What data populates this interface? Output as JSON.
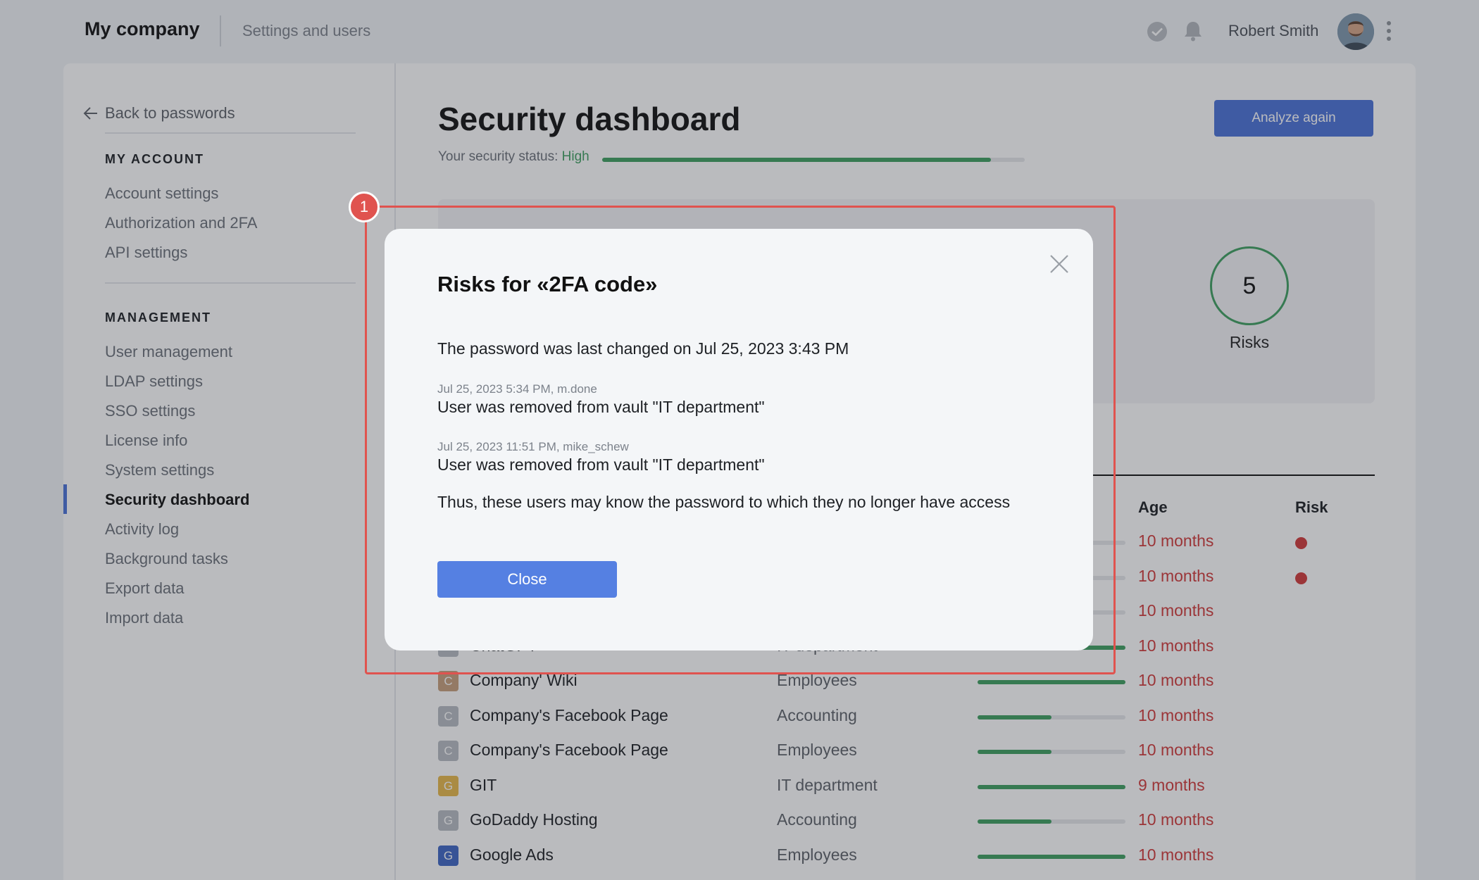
{
  "header": {
    "brand": "My company",
    "section": "Settings and users",
    "user_name": "Robert Smith"
  },
  "sidebar": {
    "back_label": "Back to passwords",
    "my_account_heading": "MY ACCOUNT",
    "my_account_items": [
      "Account settings",
      "Authorization and 2FA",
      "API settings"
    ],
    "management_heading": "MANAGEMENT",
    "management_items": [
      "User management",
      "LDAP settings",
      "SSO settings",
      "License info",
      "System settings",
      "Security dashboard",
      "Activity log",
      "Background tasks",
      "Export data",
      "Import data"
    ],
    "active_item": "Security dashboard"
  },
  "dashboard": {
    "title": "Security dashboard",
    "analyze_button": "Analyze again",
    "status_label": "Your security status:",
    "status_value": "High",
    "status_progress": 0.92,
    "risks_count": "5",
    "risks_label": "Risks",
    "columns": {
      "age": "Age",
      "risk": "Risk"
    },
    "rows": [
      {
        "name": "",
        "vault": "",
        "strength": 0.5,
        "age": "10 months",
        "risk": true
      },
      {
        "name": "",
        "vault": "",
        "strength": 0.5,
        "age": "10 months",
        "risk": true
      },
      {
        "name": "",
        "vault": "",
        "strength": 0.5,
        "age": "10 months",
        "risk": false
      },
      {
        "name": "ChatGPT",
        "letter": "C",
        "badge_color": "#b7bcc3",
        "vault": "IT department",
        "strength": 1.0,
        "age": "10 months",
        "risk": false
      },
      {
        "name": "Company' Wiki",
        "letter": "C",
        "badge_color": "#c7a07c",
        "vault": "Employees",
        "strength": 1.0,
        "age": "10 months",
        "risk": false
      },
      {
        "name": "Company's Facebook Page",
        "letter": "C",
        "badge_color": "#b7bcc3",
        "vault": "Accounting",
        "strength": 0.5,
        "age": "10 months",
        "risk": false
      },
      {
        "name": "Company's Facebook Page",
        "letter": "C",
        "badge_color": "#b7bcc3",
        "vault": "Employees",
        "strength": 0.5,
        "age": "10 months",
        "risk": false
      },
      {
        "name": "GIT",
        "letter": "G",
        "badge_color": "#e8b84a",
        "vault": "IT department",
        "strength": 1.0,
        "age": "9 months",
        "risk": false
      },
      {
        "name": "GoDaddy Hosting",
        "letter": "G",
        "badge_color": "#b7bcc3",
        "vault": "Accounting",
        "strength": 0.5,
        "age": "10 months",
        "risk": false
      },
      {
        "name": "Google Ads",
        "letter": "G",
        "badge_color": "#3f66c4",
        "vault": "Employees",
        "strength": 1.0,
        "age": "10 months",
        "risk": false
      }
    ]
  },
  "annotation": {
    "marker": "1",
    "color": "#e0534f"
  },
  "modal": {
    "title": "Risks for «2FA code»",
    "last_changed": "The password was last changed on Jul 25, 2023 3:43 PM",
    "events": [
      {
        "meta": "Jul 25, 2023 5:34 PM, m.done",
        "text": "User was removed from vault \"IT department\""
      },
      {
        "meta": "Jul 25, 2023 11:51 PM, mike_schew",
        "text": "User was removed from vault \"IT department\""
      }
    ],
    "conclusion": "Thus, these users may know the password to which they no longer have access",
    "close_button": "Close"
  },
  "colors": {
    "accent": "#4a72d8",
    "success": "#3ea060",
    "danger": "#d23a3a"
  },
  "icons": [
    "arrow-left-icon",
    "check-circle-icon",
    "bell-icon",
    "more-vertical-icon",
    "close-icon"
  ]
}
